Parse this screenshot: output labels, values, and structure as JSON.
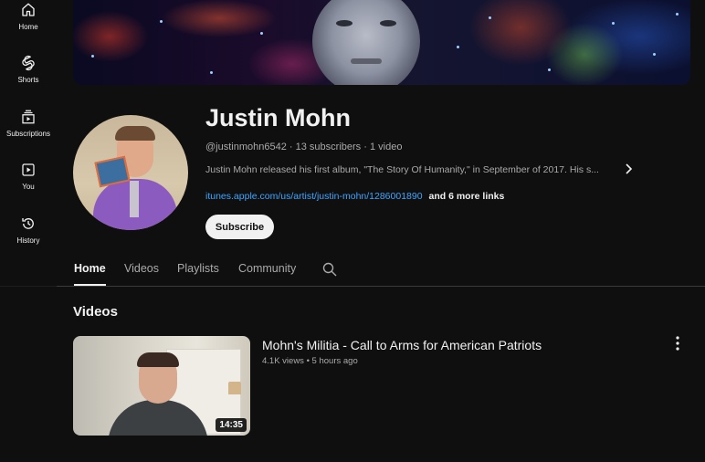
{
  "nav": {
    "items": [
      {
        "label": "Home",
        "icon": "home-icon"
      },
      {
        "label": "Shorts",
        "icon": "shorts-icon"
      },
      {
        "label": "Subscriptions",
        "icon": "subscriptions-icon"
      },
      {
        "label": "You",
        "icon": "you-icon"
      },
      {
        "label": "History",
        "icon": "history-icon"
      }
    ]
  },
  "channel": {
    "name": "Justin Mohn",
    "handle": "@justinmohn6542",
    "subscribers": "13 subscribers",
    "videos_count": "1 video",
    "description": "Justin Mohn released his first album, \"The Story Of Humanity,\" in September of 2017. His s...",
    "link": "itunes.apple.com/us/artist/justin-mohn/1286001890",
    "more_links": "and 6 more links",
    "subscribe_label": "Subscribe"
  },
  "tabs": [
    {
      "label": "Home",
      "active": true
    },
    {
      "label": "Videos",
      "active": false
    },
    {
      "label": "Playlists",
      "active": false
    },
    {
      "label": "Community",
      "active": false
    }
  ],
  "section": {
    "title": "Videos"
  },
  "video": {
    "title": "Mohn's Militia - Call to Arms for American Patriots",
    "views": "4.1K views",
    "age": "5 hours ago",
    "duration": "14:35"
  },
  "colors": {
    "background": "#0f0f0f",
    "link": "#3ea6ff",
    "secondary_text": "#aaaaaa"
  }
}
